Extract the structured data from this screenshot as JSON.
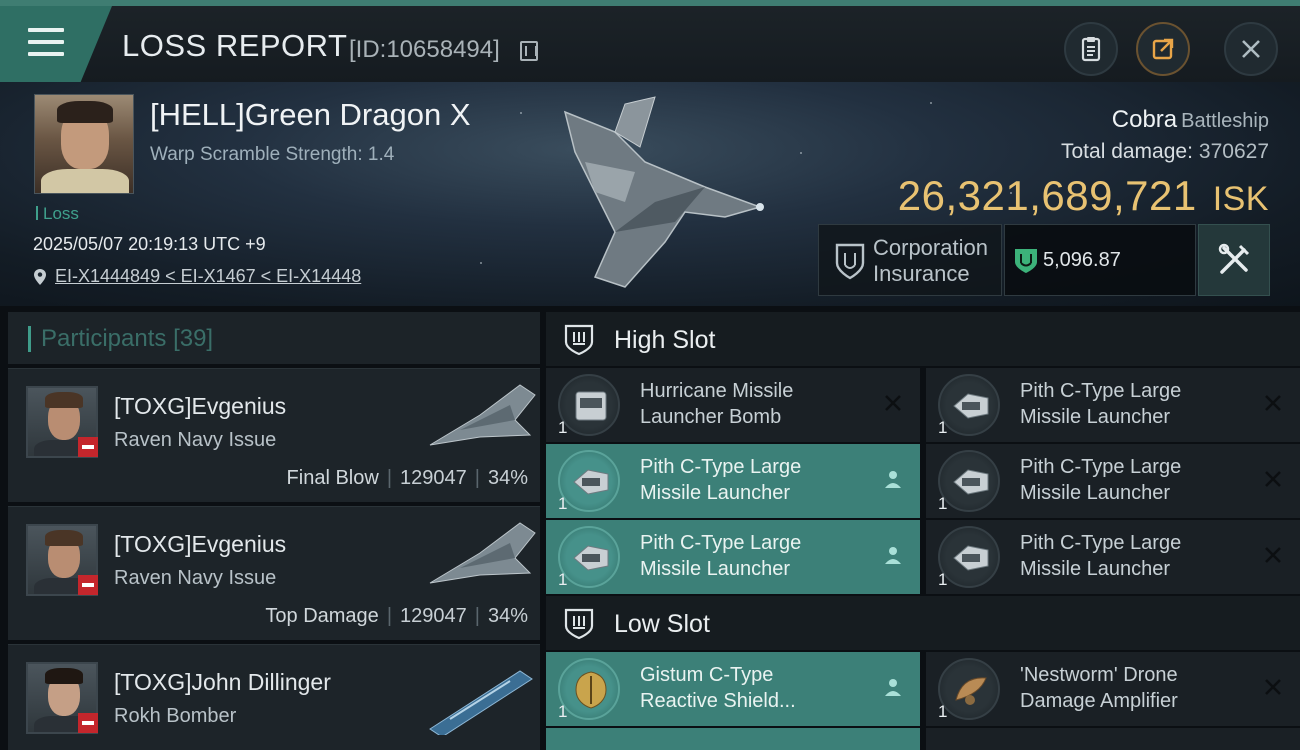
{
  "header": {
    "title": "LOSS REPORT",
    "report_id": "[ID:10658494]",
    "icons": [
      "menu-icon",
      "copy-icon",
      "clipboard-icon",
      "share-icon",
      "close-icon"
    ]
  },
  "victim": {
    "pilot_name": "[HELL]Green Dragon X",
    "scramble": "Warp Scramble Strength: 1.4",
    "status": "Loss",
    "timestamp": "2025/05/07 20:19:13 UTC +9",
    "location": "EI-X1444849 < EI-X1467 < EI-X14448",
    "ship_name": "Cobra",
    "ship_class": "Battleship",
    "total_damage_label": "Total damage:",
    "total_damage": "370627",
    "isk_value": "26,321,689,721",
    "isk_unit": "ISK",
    "insurance_label_1": "Corporation",
    "insurance_label_2": "Insurance",
    "insurance_amount": "5,096.87"
  },
  "participants": {
    "title": "Participants",
    "count": "[39]",
    "items": [
      {
        "name": "[TOXG]Evgenius",
        "ship": "Raven Navy Issue",
        "role": "Final Blow",
        "damage": "129047",
        "percent": "34%"
      },
      {
        "name": "[TOXG]Evgenius",
        "ship": "Raven Navy Issue",
        "role": "Top Damage",
        "damage": "129047",
        "percent": "34%"
      },
      {
        "name": "[TOXG]John Dillinger",
        "ship": "Rokh Bomber",
        "role": "",
        "damage": "",
        "percent": ""
      }
    ]
  },
  "fitting": {
    "high_slot_label": "High Slot",
    "low_slot_label": "Low Slot",
    "high": [
      {
        "line1": "Hurricane Missile",
        "line2": "Launcher Bomb",
        "qty": "1",
        "state": "destroyed"
      },
      {
        "line1": "Pith C-Type Large",
        "line2": "Missile Launcher",
        "qty": "1",
        "state": "destroyed"
      },
      {
        "line1": "Pith C-Type Large",
        "line2": "Missile Launcher",
        "qty": "1",
        "state": "dropped"
      },
      {
        "line1": "Pith C-Type Large",
        "line2": "Missile Launcher",
        "qty": "1",
        "state": "destroyed"
      },
      {
        "line1": "Pith C-Type Large",
        "line2": "Missile Launcher",
        "qty": "1",
        "state": "dropped"
      },
      {
        "line1": "Pith C-Type Large",
        "line2": "Missile Launcher",
        "qty": "1",
        "state": "destroyed"
      }
    ],
    "low": [
      {
        "line1": "Gistum C-Type",
        "line2": "Reactive Shield...",
        "qty": "1",
        "state": "dropped"
      },
      {
        "line1": "'Nestworm' Drone",
        "line2": "Damage Amplifier",
        "qty": "1",
        "state": "destroyed"
      }
    ]
  },
  "colors": {
    "accent": "#3f7d72",
    "isk": "#e8c272",
    "dropped_bg": "#3c8078",
    "loss_badge": "#c4262c"
  }
}
